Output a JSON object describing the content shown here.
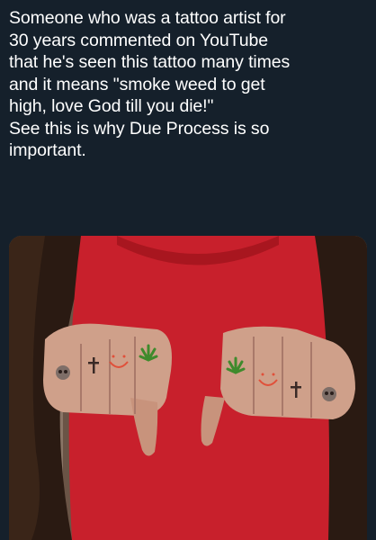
{
  "post": {
    "text_lines": [
      "Someone who was a tattoo artist for",
      "30 years commented on YouTube",
      "that he's seen this tattoo many times",
      "and it means \"smoke weed to get",
      "high, love God till you die!\"",
      "See this is why Due Process is so",
      "important."
    ]
  },
  "media": {
    "subject": "person in red t-shirt showing knuckle tattoos",
    "tattoos_left_hand": [
      "skull",
      "cross",
      "smiley",
      "cannabis-leaf"
    ],
    "tattoos_right_hand": [
      "cannabis-leaf",
      "smiley",
      "cross",
      "skull"
    ],
    "colors": {
      "shirt": "#c8202c",
      "skin": "#cfa08a",
      "hair": "#2a1a12",
      "background": "#15202b"
    }
  }
}
